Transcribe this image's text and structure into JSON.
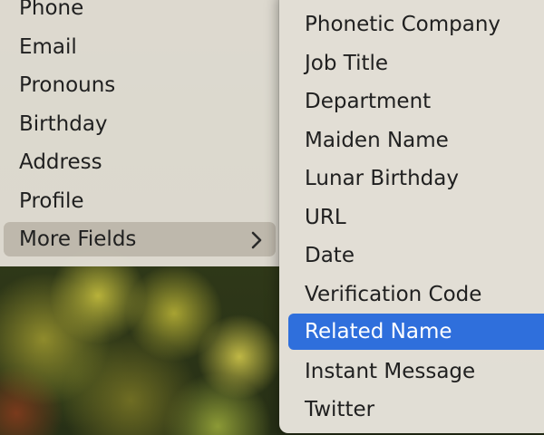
{
  "main_menu": {
    "items": [
      {
        "label": "Phone"
      },
      {
        "label": "Email"
      },
      {
        "label": "Pronouns"
      },
      {
        "label": "Birthday"
      },
      {
        "label": "Address"
      },
      {
        "label": "Profile"
      },
      {
        "label": "More Fields",
        "has_submenu": true,
        "highlighted": true
      }
    ],
    "chevron_icon": "chevron-right"
  },
  "submenu": {
    "items": [
      {
        "label": "Phonetic Company"
      },
      {
        "label": "Job Title"
      },
      {
        "label": "Department"
      },
      {
        "label": "Maiden Name"
      },
      {
        "label": "Lunar Birthday"
      },
      {
        "label": "URL"
      },
      {
        "label": "Date"
      },
      {
        "label": "Verification Code"
      },
      {
        "label": "Related Name",
        "selected": true
      },
      {
        "label": "Instant Message"
      },
      {
        "label": "Twitter"
      }
    ],
    "selection_color": "#2f6fdc"
  }
}
